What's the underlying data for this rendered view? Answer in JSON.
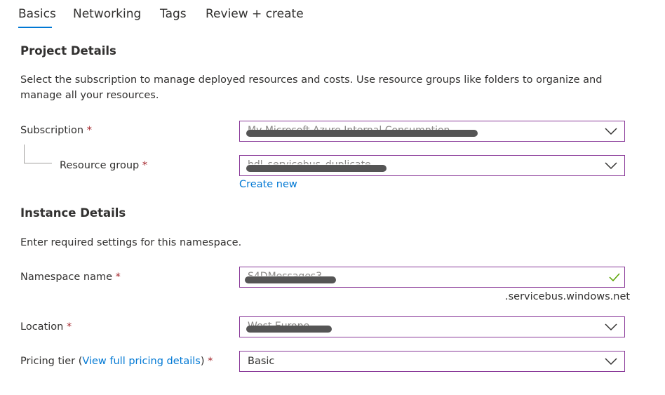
{
  "tabs": [
    {
      "label": "Basics"
    },
    {
      "label": "Networking"
    },
    {
      "label": "Tags"
    },
    {
      "label": "Review + create"
    }
  ],
  "project": {
    "title": "Project Details",
    "description": "Select the subscription to manage deployed resources and costs. Use resource groups like folders to organize and manage all your resources.",
    "subscription_label": "Subscription",
    "subscription_value": "My Microsoft Azure Internal Consumption",
    "resource_group_label": "Resource group",
    "resource_group_value": "bdl_servicebus_duplicate",
    "create_new": "Create new"
  },
  "instance": {
    "title": "Instance Details",
    "description": "Enter required settings for this namespace.",
    "namespace_label": "Namespace name",
    "namespace_value": "S4DMessages3",
    "namespace_suffix": ".servicebus.windows.net",
    "location_label": "Location",
    "location_value": "West Europe",
    "pricing_label_prefix": "Pricing tier (",
    "pricing_link": "View full pricing details",
    "pricing_label_suffix": ")",
    "pricing_value": "Basic"
  },
  "required_marker": "*",
  "colors": {
    "accent": "#0078d4",
    "field_border": "#8a3a99",
    "required": "#a4262c",
    "valid": "#57a300"
  }
}
